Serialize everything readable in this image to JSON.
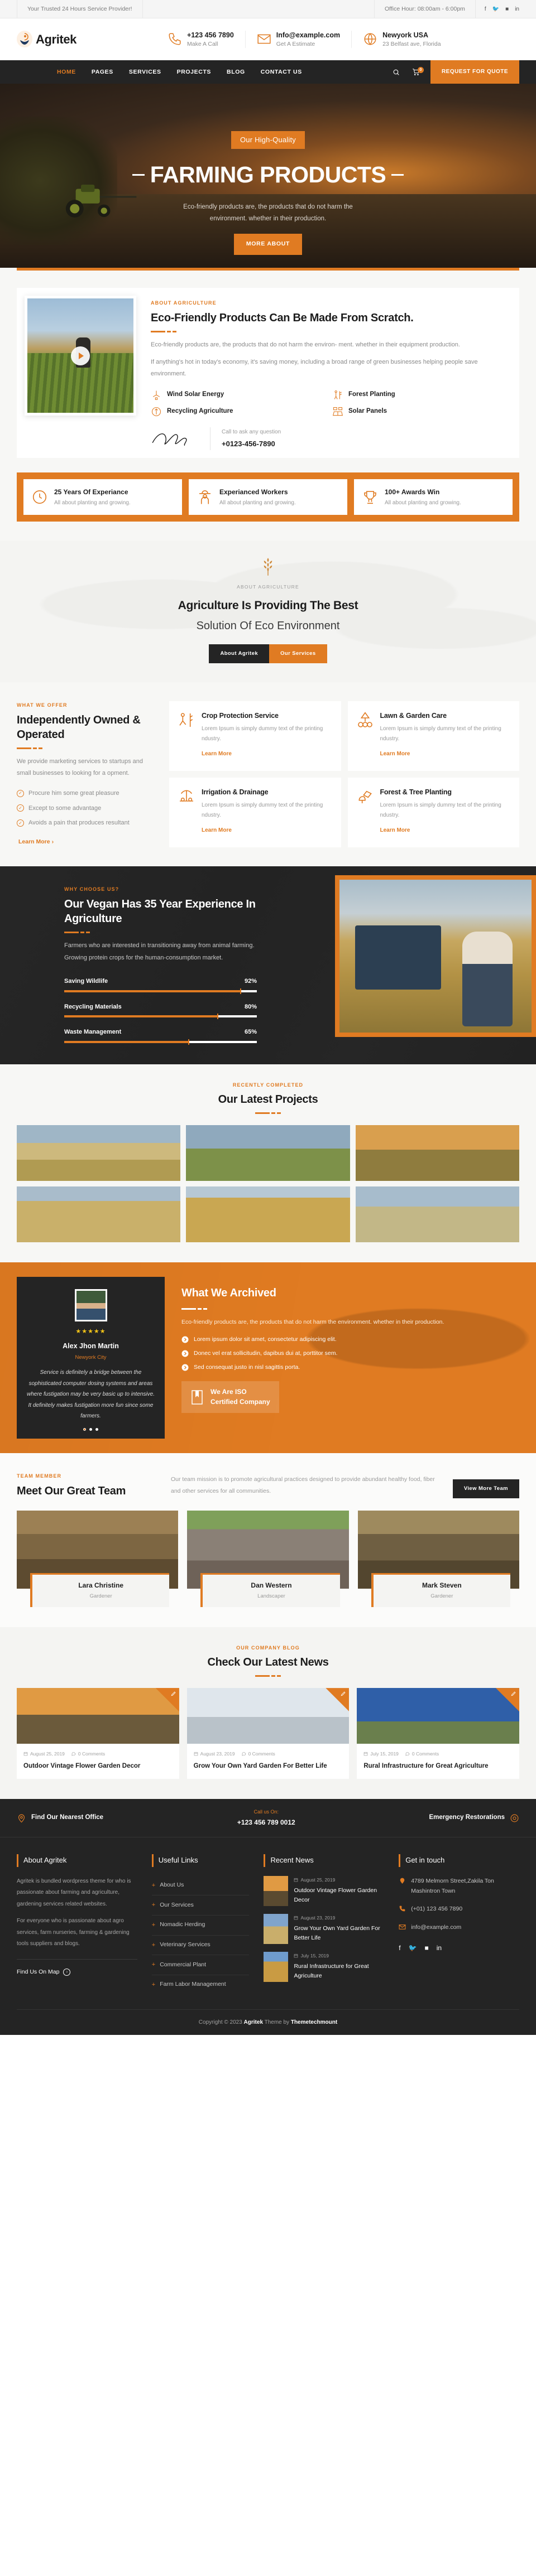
{
  "topbar": {
    "tagline": "Your Trusted 24 Hours Service Provider!",
    "office_hour": "Office Hour: 08:00am - 6:00pm",
    "social": [
      "facebook-icon",
      "twitter-icon",
      "flickr-icon",
      "linkedin-icon"
    ]
  },
  "header": {
    "brand": "Agritek",
    "info": [
      {
        "icon": "phone-icon",
        "title": "+123 456 7890",
        "sub": "Make A Call"
      },
      {
        "icon": "envelope-icon",
        "title": "Info@example.com",
        "sub": "Get A Estimate"
      },
      {
        "icon": "globe-icon",
        "title": "Newyork USA",
        "sub": "23 Belfast ave, Florida"
      }
    ]
  },
  "nav": {
    "items": [
      "HOME",
      "PAGES",
      "SERVICES",
      "PROJECTS",
      "BLOG",
      "CONTACT US"
    ],
    "active": "HOME",
    "cart_count": "0",
    "quote_button": "REQUEST FOR QUOTE"
  },
  "hero": {
    "badge": "Our High-Quality",
    "title": "FARMING PRODUCTS",
    "subtitle": "Eco-friendly products are, the products that do not harm the environment. whether in their production.",
    "cta": "MORE ABOUT"
  },
  "about": {
    "eyebrow": "ABOUT AGRICULTURE",
    "title": "Eco-Friendly Products Can Be Made From Scratch.",
    "p1": "Eco-friendly products are, the products that do not harm the environ- ment. whether in their equipment production.",
    "p2": "If anything's hot in today's economy, it's saving money, including a broad range of green businesses helping people save environment.",
    "features": [
      {
        "icon": "wind-turbine-icon",
        "label": "Wind Solar Energy"
      },
      {
        "icon": "forest-planting-icon",
        "label": "Forest Planting"
      },
      {
        "icon": "recycling-icon",
        "label": "Recycling Agriculture"
      },
      {
        "icon": "solar-panel-icon",
        "label": "Solar Panels"
      }
    ],
    "call_label": "Call to ask any question",
    "call_number": "+0123-456-7890"
  },
  "stats": [
    {
      "icon": "clock-icon",
      "title": "25 Years Of Experiance",
      "sub": "All about planting and growing."
    },
    {
      "icon": "farmer-icon",
      "title": "Experianced Workers",
      "sub": "All about planting and growing."
    },
    {
      "icon": "trophy-icon",
      "title": "100+ Awards Win",
      "sub": "All about planting and growing."
    }
  ],
  "intro": {
    "eyebrow": "ABOUT AGRICULTURE",
    "line1": "Agriculture Is Providing The Best",
    "line2": "Solution Of Eco Environment",
    "btn_dark": "About Agritek",
    "btn_orange": "Our Services"
  },
  "offer": {
    "eyebrow": "WHAT WE OFFER",
    "title": "Independently Owned & Operated",
    "paragraph": "We provide marketing services to startups and small businesses to looking for a opment.",
    "checks": [
      "Procure him some great pleasure",
      "Except to some advantage",
      "Avoids a pain that produces resultant"
    ],
    "learn_more": "Learn More",
    "services": [
      {
        "icon": "crop-protection-icon",
        "title": "Crop Protection Service",
        "desc": "Lorem Ipsum is simply dummy text of the printing ndustry.",
        "link": "Learn More"
      },
      {
        "icon": "lawn-garden-icon",
        "title": "Lawn & Garden Care",
        "desc": "Lorem Ipsum is simply dummy text of the printing ndustry.",
        "link": "Learn More"
      },
      {
        "icon": "irrigation-icon",
        "title": "Irrigation & Drainage",
        "desc": "Lorem Ipsum is simply dummy text of the printing ndustry.",
        "link": "Learn More"
      },
      {
        "icon": "tree-planting-icon",
        "title": "Forest & Tree Planting",
        "desc": "Lorem Ipsum is simply dummy text of the printing ndustry.",
        "link": "Learn More"
      }
    ]
  },
  "why": {
    "eyebrow": "WHY CHOOSE US?",
    "title": "Our Vegan Has 35 Year Experience In Agriculture",
    "paragraph": "Farmers who are interested in transitioning away from animal farming. Growing protein crops for the human-consumption market.",
    "bars": [
      {
        "label": "Saving Wildlife",
        "value": 92,
        "pct": "92%"
      },
      {
        "label": "Recycling Materials",
        "value": 80,
        "pct": "80%"
      },
      {
        "label": "Waste Management",
        "value": 65,
        "pct": "65%"
      }
    ]
  },
  "projects": {
    "eyebrow": "RECENTLY COMPLETED",
    "title": "Our Latest Projects",
    "items": [
      "combine-harvester-field",
      "two-farmers-walking-field",
      "sunset-crop-field",
      "woman-in-wheat-field",
      "tractor-ploughing-field",
      "farmers-inspecting-crops"
    ]
  },
  "archived": {
    "title": "What We Archived",
    "paragraph": "Eco-friendly products are, the products that do not harm the environment. whether in their production.",
    "bullets": [
      "Lorem ipsum dolor sit amet, consectetur adipiscing elit.",
      "Donec vel erat sollicitudin, dapibus dui at, porttitor sem.",
      "Sed consequat justo in nisl sagittis porta."
    ],
    "iso_line1": "We Are ISO",
    "iso_line2": "Certified Company",
    "testimonial": {
      "stars": "★★★★★",
      "name": "Alex Jhon Martin",
      "role": "Newyork City",
      "quote": "Service is definitely a bridge between the sophisticated computer dosing systems and areas where fustigation may be very basic up to intensive. It definitely makes fustigation more fun since some farmers."
    }
  },
  "team": {
    "eyebrow": "TEAM MEMBER",
    "title": "Meet Our Great Team",
    "description": "Our team mission is to promote agricultural practices designed to provide abundant healthy food, fiber and other services for all communities.",
    "button": "View More Team",
    "members": [
      {
        "name": "Lara Christine",
        "role": "Gardener"
      },
      {
        "name": "Dan Western",
        "role": "Landscaper"
      },
      {
        "name": "Mark Steven",
        "role": "Gardener"
      }
    ]
  },
  "blog": {
    "eyebrow": "OUR COMPANY BLOG",
    "title": "Check Our Latest News",
    "posts": [
      {
        "date": "August 25, 2019",
        "comments": "0 Comments",
        "title": "Outdoor Vintage Flower Garden Decor"
      },
      {
        "date": "August 23, 2019",
        "comments": "0 Comments",
        "title": "Grow Your Own Yard Garden For Better Life"
      },
      {
        "date": "July 15, 2019",
        "comments": "0 Comments",
        "title": "Rural Infrastructure for Great Agriculture"
      }
    ]
  },
  "contact_strip": {
    "left": "Find Our Nearest Office",
    "call_label": "Call us On:",
    "call_number": "+123 456 789 0012",
    "right": "Emergency Restorations"
  },
  "footer": {
    "about": {
      "heading": "About Agritek",
      "p1": "Agritek is bundled wordpress theme for who is passionate about farming and agriculture, gardening services related websites.",
      "p2": "For everyone who is passionate about agro services, farm nurseries, farming & gardening tools suppliers and blogs.",
      "map_link": "Find Us On Map"
    },
    "links": {
      "heading": "Useful Links",
      "items": [
        "About Us",
        "Our Services",
        "Nomadic Herding",
        "Veterinary Services",
        "Commercial Plant",
        "Farm Labor Management"
      ]
    },
    "news": {
      "heading": "Recent News",
      "items": [
        {
          "date": "August 25, 2019",
          "title": "Outdoor Vintage Flower Garden Decor"
        },
        {
          "date": "August 23, 2019",
          "title": "Grow Your Own Yard Garden For Better Life"
        },
        {
          "date": "July 15, 2019",
          "title": "Rural Infrastructure for Great Agriculture"
        }
      ]
    },
    "contact": {
      "heading": "Get in touch",
      "address": "4789 Melmorn Street,Zakila Ton Mashintron Town",
      "phone": "(+01) 123 456 7890",
      "email": "info@example.com",
      "social": [
        "facebook-icon",
        "twitter-icon",
        "flickr-icon",
        "linkedin-icon"
      ]
    },
    "copyright_pre": "Copyright © 2023 ",
    "copyright_brand": "Agritek",
    "copyright_mid": " Theme by ",
    "copyright_author": "Themetechmount"
  }
}
